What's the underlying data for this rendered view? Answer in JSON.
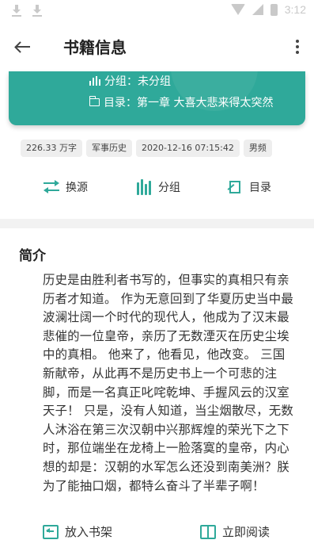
{
  "status_bar": {
    "time": "3:12"
  },
  "app_bar": {
    "title": "书籍信息"
  },
  "book": {
    "group_label": "分组：未分组",
    "catalog_label": "目录：第一章 大喜大悲来得太突然"
  },
  "tags": [
    "226.33 万字",
    "军事历史",
    "2020-12-16 07:15:42",
    "男频"
  ],
  "actions": {
    "change_source": "换源",
    "group": "分组",
    "catalog": "目录"
  },
  "intro": {
    "title": "简介",
    "text": "历史是由胜利者书写的，但事实的真相只有亲历者才知道。 作为无意回到了华夏历史当中最波澜壮阔一个时代的现代人，他成为了汉末最悲催的一位皇帝，亲历了无数湮灭在历史尘埃中的真相。 他来了，他看见，他改变。 三国新献帝，从此再不是历史书上一个可悲的注脚，而是一名真正叱咤乾坤、手握风云的汉室天子！ 只是，没有人知道，当尘烟散尽，无数人沐浴在第三次汉朝中兴那辉煌的荣光下之下时，那位端坐在龙椅上一脸落寞的皇帝，内心想的却是：汉朝的水军怎么还没到南美洲？朕为了能抽口烟，都特么奋斗了半辈子啊！"
  },
  "bottom": {
    "add_to_shelf": "放入书架",
    "read_now": "立即阅读"
  },
  "colors": {
    "accent": "#2fa99a",
    "divider": "#f2f2f2",
    "tag_bg": "#eeeeee"
  }
}
